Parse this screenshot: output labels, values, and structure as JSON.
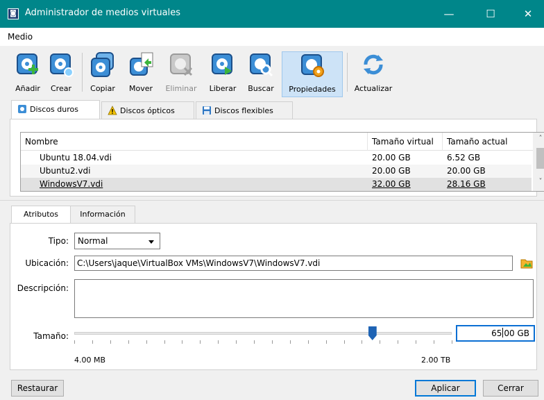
{
  "window": {
    "title": "Administrador de medios virtuales",
    "app_icon_glyph": "◙"
  },
  "controls": {
    "minimize": "—",
    "maximize": "☐",
    "close": "✕"
  },
  "menu": {
    "items": [
      "Medio"
    ]
  },
  "toolbar": {
    "add": "Añadir",
    "create": "Crear",
    "copy": "Copiar",
    "move": "Mover",
    "remove": "Eliminar",
    "release": "Liberar",
    "search": "Buscar",
    "properties": "Propiedades",
    "refresh": "Actualizar"
  },
  "media_tabs": {
    "hard": "Discos duros",
    "optical": "Discos ópticos",
    "floppy": "Discos flexibles"
  },
  "table": {
    "sort_glyph": "^",
    "headers": {
      "name": "Nombre",
      "virtual": "Tamaño virtual",
      "actual": "Tamaño actual"
    },
    "rows": [
      {
        "name": "Ubuntu 18.04.vdi",
        "virtual": "20.00 GB",
        "actual": "6.52 GB"
      },
      {
        "name": "Ubuntu2.vdi",
        "virtual": "20.00 GB",
        "actual": "20.00 GB"
      },
      {
        "name": "WindowsV7.vdi",
        "virtual": "32.00 GB",
        "actual": "28.16 GB"
      }
    ]
  },
  "detail_tabs": {
    "attributes": "Atributos",
    "info": "Información"
  },
  "attributes": {
    "type_label": "Tipo:",
    "type_value": "Normal",
    "location_label": "Ubicación:",
    "location_value": "C:\\Users\\jaque\\VirtualBox VMs\\WindowsV7\\WindowsV7.vdi",
    "description_label": "Descripción:",
    "description_value": "",
    "size_label": "Tamaño:",
    "size_value_a": "65",
    "size_value_b": "00 GB",
    "size_min": "4.00 MB",
    "size_max": "2.00 TB",
    "slider_fraction": 0.79
  },
  "buttons": {
    "reset": "Restaurar",
    "apply": "Aplicar",
    "close": "Cerrar"
  }
}
